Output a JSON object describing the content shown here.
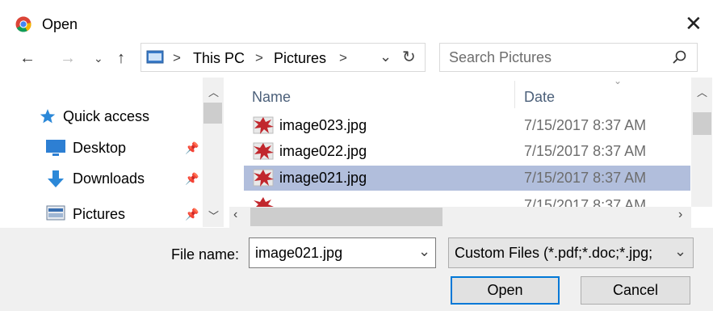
{
  "window": {
    "title": "Open"
  },
  "address_bar": {
    "path": [
      "This PC",
      "Pictures"
    ]
  },
  "search": {
    "placeholder": "Search Pictures"
  },
  "nav_pane": {
    "items": [
      {
        "label": "Quick access",
        "icon": "star-icon"
      },
      {
        "label": "Desktop",
        "icon": "desktop-icon",
        "pinned": true
      },
      {
        "label": "Downloads",
        "icon": "download-arrow-icon",
        "pinned": true
      },
      {
        "label": "Pictures",
        "icon": "pictures-folder-icon",
        "pinned": true
      }
    ]
  },
  "file_list": {
    "columns": [
      "Name",
      "Date"
    ],
    "rows": [
      {
        "name": "image023.jpg",
        "date": "7/15/2017 8:37 AM"
      },
      {
        "name": "image022.jpg",
        "date": "7/15/2017 8:37 AM"
      },
      {
        "name": "image021.jpg",
        "date": "7/15/2017 8:37 AM",
        "selected": true
      }
    ],
    "partial_row_date": "7/15/2017 8:37 AM"
  },
  "footer": {
    "file_name_label": "File name:",
    "file_name_value": "image021.jpg",
    "file_type_value": "Custom Files (*.pdf;*.doc;*.jpg;",
    "open_label": "Open",
    "cancel_label": "Cancel"
  },
  "colors": {
    "selection": "#b1bedc",
    "footer_bg": "#f0f0f0",
    "accent_border": "#0078d7",
    "column_header": "#4c607a"
  }
}
